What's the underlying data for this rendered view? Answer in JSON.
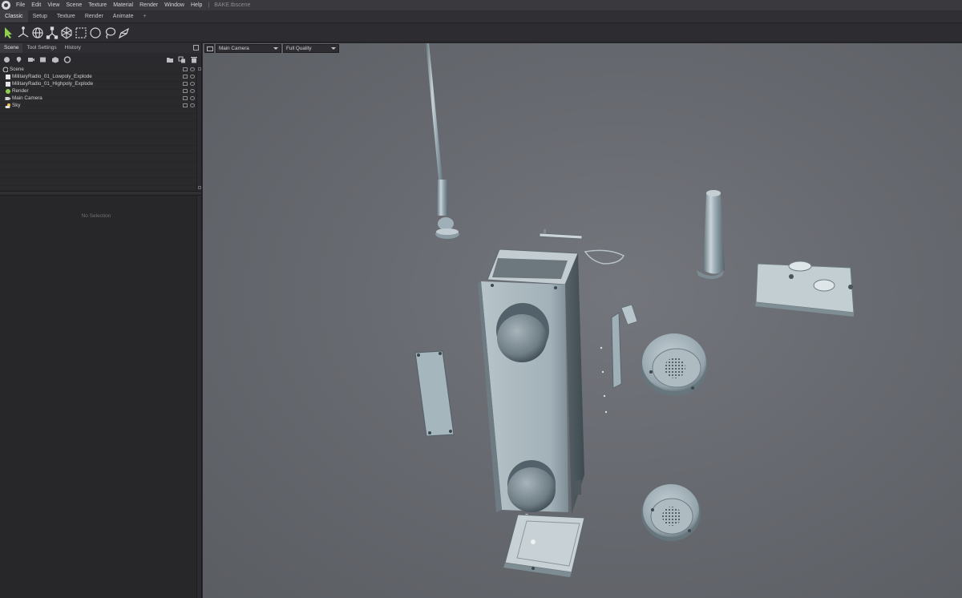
{
  "menubar": {
    "items": [
      "File",
      "Edit",
      "View",
      "Scene",
      "Texture",
      "Material",
      "Render",
      "Window",
      "Help"
    ],
    "document_title": "BAKE.tbscene"
  },
  "workspace_tabs": [
    "Classic",
    "Setup",
    "Texture",
    "Render",
    "Animate"
  ],
  "workspace_add": "+",
  "toolbar": {
    "tools": [
      "select-arrow-icon",
      "move-gizmo-icon",
      "rotate-gizmo-icon",
      "scale-gizmo-icon",
      "transform-gizmo-icon",
      "rect-select-icon",
      "circle-select-icon",
      "lasso-select-icon",
      "paint-select-icon"
    ]
  },
  "left_panel": {
    "tabs": [
      "Scene",
      "Tool Settings",
      "History"
    ],
    "tree": [
      {
        "label": "Scene",
        "depth": 0,
        "icon": "scene-icon"
      },
      {
        "label": "MilitaryRadio_01_Lowpoly_Explode",
        "depth": 1,
        "icon": "mesh-icon"
      },
      {
        "label": "MilitaryRadio_01_Highpoly_Explode",
        "depth": 1,
        "icon": "mesh-icon"
      },
      {
        "label": "Render",
        "depth": 1,
        "icon": "render-icon"
      },
      {
        "label": "Main Camera",
        "depth": 1,
        "icon": "camera-icon"
      },
      {
        "label": "Sky",
        "depth": 1,
        "icon": "sky-icon"
      }
    ],
    "properties_empty": "No Selection"
  },
  "viewport": {
    "camera_select": "Main Camera",
    "quality_select": "Full Quality",
    "accent_color": "#8fd14f"
  }
}
